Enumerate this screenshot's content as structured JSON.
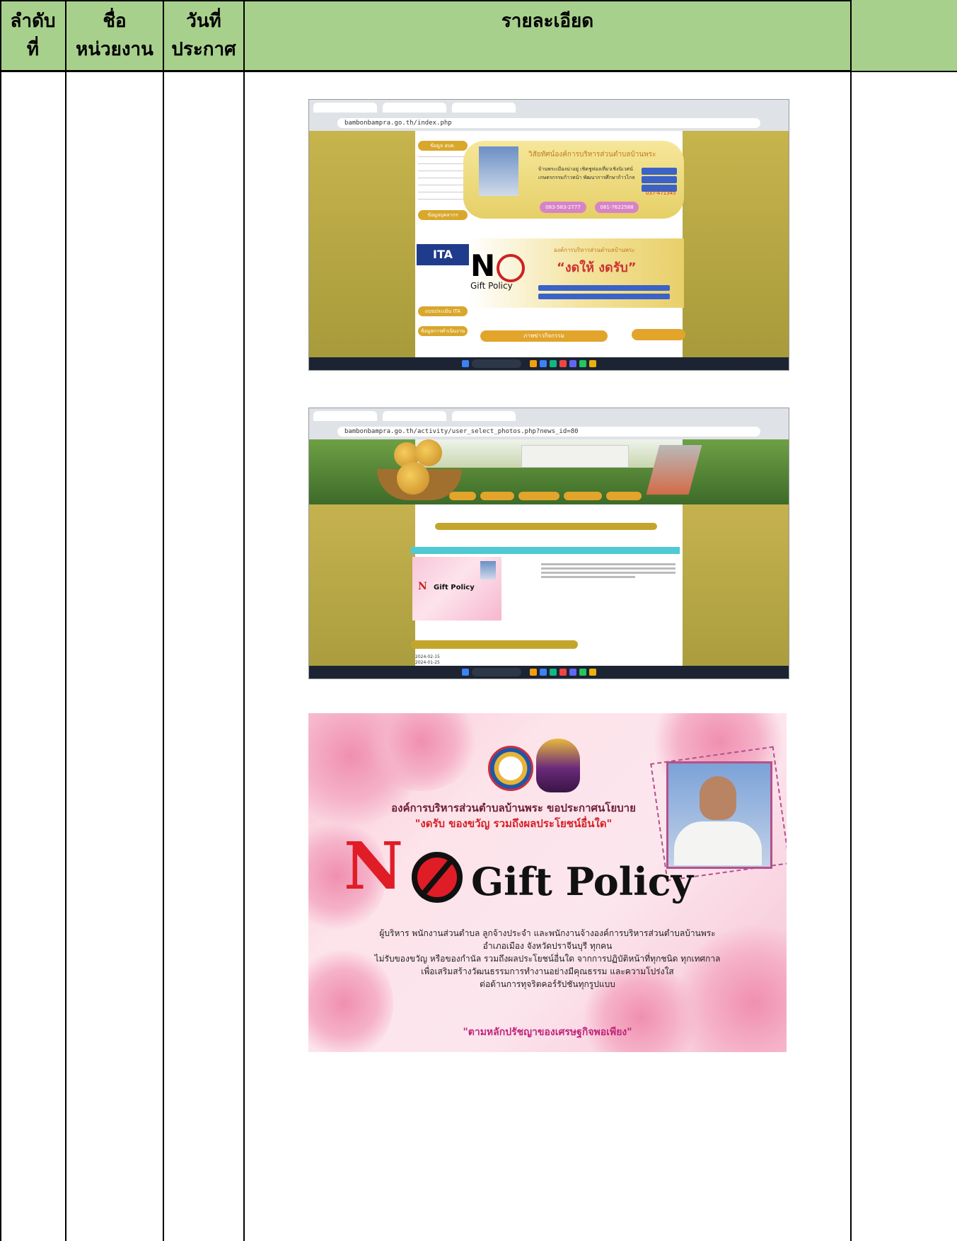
{
  "table": {
    "headers": [
      {
        "line1": "ลำดับ",
        "line2": "ที่"
      },
      {
        "line1": "ชื่อ",
        "line2": "หน่วยงาน"
      },
      {
        "line1": "วันที่",
        "line2": "ประกาศ"
      },
      {
        "line1": "รายละเอียด",
        "line2": ""
      }
    ],
    "header_color": "#a8d08d"
  },
  "screenshot1": {
    "url": "bambonbampra.go.th/index.php",
    "vision_title": "วิสัยทัศน์องค์การบริหารส่วนตำบลบ้านพระ",
    "vision_text": "บ้านพระเมืองน่าอยู่ เชิดชูท่องเที่ยวเชิงนิเวศน์ เกษตรกรรมก้าวหน้า พัฒนาการศึกษาก้าวไกล",
    "phone": "037-471345",
    "phone_2": "083-583-2777",
    "phone_3": "081-7622588",
    "gift_org": "องค์การบริหารส่วนตำบลบ้านพระ",
    "gift_slogan": "“งดให้ งดรับ”",
    "gift_policy": "Gift Policy",
    "menu_1": "ข้อมูล อบต.",
    "menu_2": "ข้อมูลบุคลากร",
    "menu_3": "แบบประเมิน ITA",
    "menu_4": "ข้อมูลการดำเนินงาน",
    "activity_label": "ภาพข่าวกิจกรรม"
  },
  "screenshot2": {
    "url": "bambonbampra.go.th/activity/user_select_photos.php?news_id=80",
    "gift_policy": "Gift Policy",
    "date_1": "2024-02-15",
    "date_2": "2024-01-25"
  },
  "poster": {
    "title_line1": "องค์การบริหารส่วนตำบลบ้านพระ ขอประกาศนโยบาย",
    "title_line2": "\"งดรับ ของขวัญ รวมถึงผลประโยชน์อื่นใด\"",
    "no_text": "N",
    "gift_policy": "Gift Policy",
    "body_lines": [
      "ผู้บริหาร พนักงานส่วนตำบล ลูกจ้างประจำ และพนักงานจ้างองค์การบริหารส่วนตำบลบ้านพระ",
      "อำเภอเมือง จังหวัดปราจีนบุรี ทุกคน",
      "ไม่รับของขวัญ หรือของกำนัล รวมถึงผลประโยชน์อื่นใด จากการปฏิบัติหน้าที่ทุกชนิด ทุกเทศกาล",
      "เพื่อเสริมสร้างวัฒนธรรมการทำงานอย่างมีคุณธรรม และความโปร่งใส",
      "ต่อต้านการทุจริตคอร์รัปชันทุกรูปแบบ"
    ],
    "footer": "\"ตามหลักปรัชญาของเศรษฐกิจพอเพียง\""
  }
}
